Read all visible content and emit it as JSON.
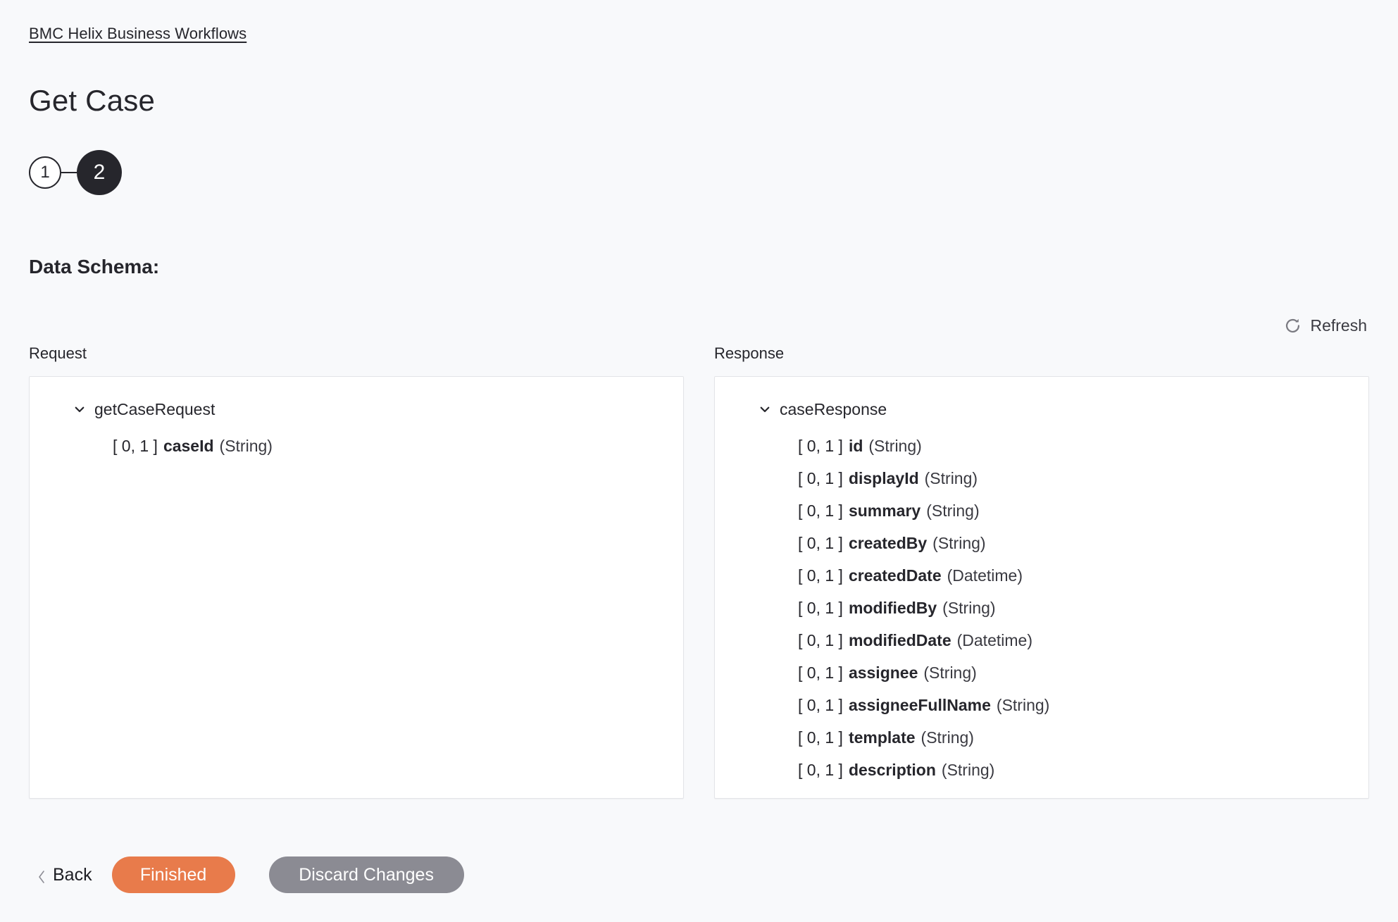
{
  "breadcrumb": {
    "label": "BMC Helix Business Workflows"
  },
  "page": {
    "title": "Get Case"
  },
  "stepper": {
    "steps": [
      {
        "label": "1",
        "state": "inactive"
      },
      {
        "label": "2",
        "state": "active"
      }
    ]
  },
  "schema": {
    "heading": "Data Schema:",
    "refresh": {
      "label": "Refresh",
      "icon": "refresh-icon"
    },
    "request": {
      "column_label": "Request",
      "root": {
        "label": "getCaseRequest",
        "expanded": true
      },
      "fields": [
        {
          "cardinality": "[ 0, 1 ]",
          "name": "caseId",
          "type": "(String)"
        }
      ]
    },
    "response": {
      "column_label": "Response",
      "root": {
        "label": "caseResponse",
        "expanded": true
      },
      "fields": [
        {
          "cardinality": "[ 0, 1 ]",
          "name": "id",
          "type": "(String)"
        },
        {
          "cardinality": "[ 0, 1 ]",
          "name": "displayId",
          "type": "(String)"
        },
        {
          "cardinality": "[ 0, 1 ]",
          "name": "summary",
          "type": "(String)"
        },
        {
          "cardinality": "[ 0, 1 ]",
          "name": "createdBy",
          "type": "(String)"
        },
        {
          "cardinality": "[ 0, 1 ]",
          "name": "createdDate",
          "type": "(Datetime)"
        },
        {
          "cardinality": "[ 0, 1 ]",
          "name": "modifiedBy",
          "type": "(String)"
        },
        {
          "cardinality": "[ 0, 1 ]",
          "name": "modifiedDate",
          "type": "(Datetime)"
        },
        {
          "cardinality": "[ 0, 1 ]",
          "name": "assignee",
          "type": "(String)"
        },
        {
          "cardinality": "[ 0, 1 ]",
          "name": "assigneeFullName",
          "type": "(String)"
        },
        {
          "cardinality": "[ 0, 1 ]",
          "name": "template",
          "type": "(String)"
        },
        {
          "cardinality": "[ 0, 1 ]",
          "name": "description",
          "type": "(String)"
        }
      ]
    }
  },
  "footer": {
    "back_label": "Back",
    "finished_label": "Finished",
    "discard_label": "Discard Changes"
  },
  "colors": {
    "page_background": "#f8f9fb",
    "panel_background": "#ffffff",
    "panel_border": "#e3e4e8",
    "text": "#26262c",
    "primary_button": "#e87b4b",
    "secondary_button": "#8b8b93",
    "step_active": "#26262c",
    "refresh_icon": "#7b7b82"
  }
}
